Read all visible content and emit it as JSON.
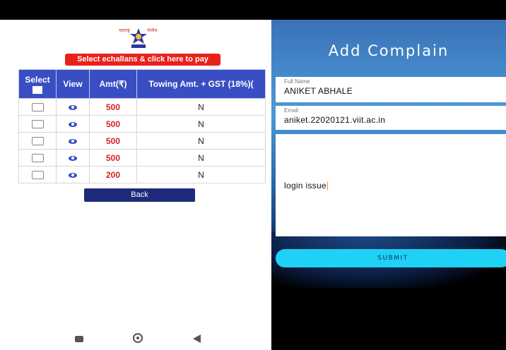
{
  "left": {
    "pay_button": "Select echallans & click here to pay",
    "table": {
      "headers": [
        "Select",
        "View",
        "Amt(₹)",
        "Towing Amt. + GST (18%)("
      ],
      "rows": [
        {
          "amount": "500",
          "towing": "N"
        },
        {
          "amount": "500",
          "towing": "N"
        },
        {
          "amount": "500",
          "towing": "N"
        },
        {
          "amount": "500",
          "towing": "N"
        },
        {
          "amount": "200",
          "towing": "N"
        }
      ]
    },
    "back_button": "Back",
    "colors": {
      "header_bg": "#3a4ec4",
      "pay_bg": "#e8211b",
      "amount_text": "#d62020",
      "back_bg": "#1f2b7a"
    }
  },
  "right": {
    "title": "Add Complain",
    "full_name": {
      "label": "Full Name",
      "value": "ANIKET ABHALE"
    },
    "email": {
      "label": "Email",
      "value": "aniket.22020121.viit.ac.in"
    },
    "description": {
      "value": "login issue"
    },
    "submit_button": "SUBMIT",
    "colors": {
      "submit_bg": "#1fd1f5"
    }
  },
  "nav_icons": [
    "recent-apps-icon",
    "home-icon",
    "back-icon"
  ]
}
